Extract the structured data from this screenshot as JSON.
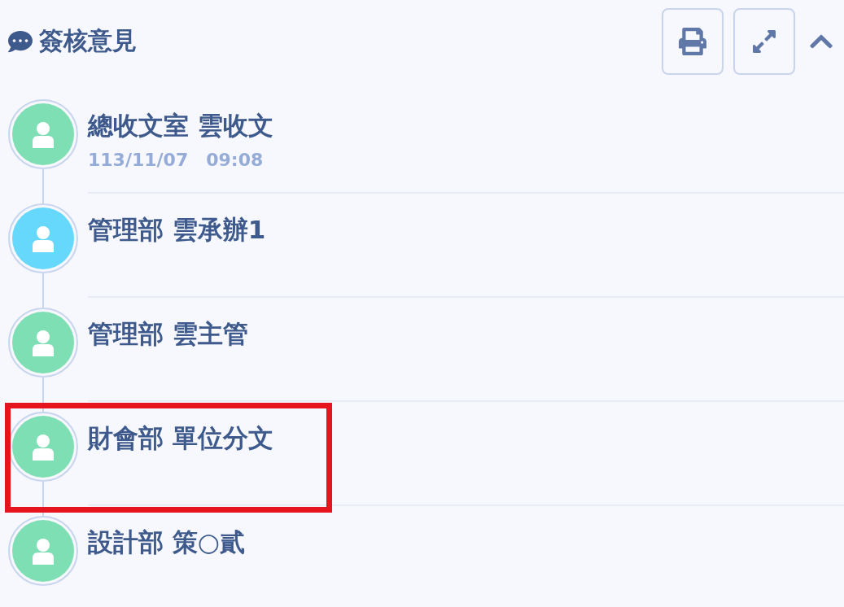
{
  "panel": {
    "title": "簽核意見"
  },
  "timeline": [
    {
      "name": "總收文室 雲收文",
      "time": "113/11/07　09:08",
      "color": "#7fdfb4",
      "highlighted": false
    },
    {
      "name": "管理部 雲承辦1",
      "color": "#66d8fc",
      "highlighted": false
    },
    {
      "name": "管理部 雲主管",
      "color": "#7fdfb4",
      "highlighted": false
    },
    {
      "name": "財會部 單位分文",
      "color": "#7fdfb4",
      "highlighted": true
    },
    {
      "name": "設計部 策○貳",
      "color": "#7fdfb4",
      "highlighted": false
    }
  ]
}
